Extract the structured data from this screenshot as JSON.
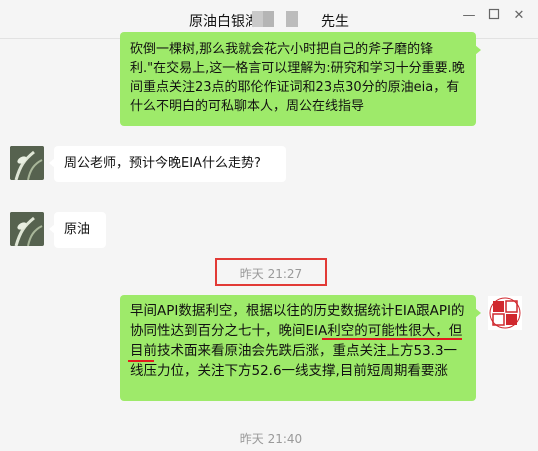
{
  "window": {
    "title": "原油白银湖南",
    "title_suffix": "先生",
    "controls": [
      "minimize-icon",
      "maximize-icon",
      "close-icon"
    ]
  },
  "messages": [
    {
      "sender": "self",
      "text": "砍倒一棵树,那么我就会花六小时把自己的斧子磨的锋利.\"在交易上,这一格言可以理解为:研究和学习十分重要.晚间重点关注23点的耶伦作证词和23点30分的原油eia，有什么不明白的可私聊本人，周公在线指导"
    },
    {
      "sender": "other",
      "text": "周公老师，预计今晚EIA什么走势?"
    },
    {
      "sender": "other",
      "text": "原油"
    },
    {
      "type": "timestamp",
      "text": "昨天 21:27"
    },
    {
      "sender": "self",
      "text_part1": "早间API数据利空，根据以往的历史数据统计EIA跟API的协同性达到百分之七十，",
      "text_highlight": "晚间EIA利空的可能性很大",
      "text_part2": "，但目前技术面来看原油会先跌后涨，重点关注上方53.3一线压力位，关注下方52.6一线支撑,目前短周期看要涨"
    },
    {
      "type": "timestamp",
      "text": "昨天 21:40"
    }
  ],
  "seal_avatar": {
    "chars": [
      "周",
      "公",
      "周",
      "公"
    ],
    "color": "#d0282e"
  },
  "colors": {
    "self_bubble": "#9eea6a",
    "other_bubble": "#ffffff",
    "highlight_underline": "#e21b1b",
    "timestamp_box": "#e23a36"
  }
}
